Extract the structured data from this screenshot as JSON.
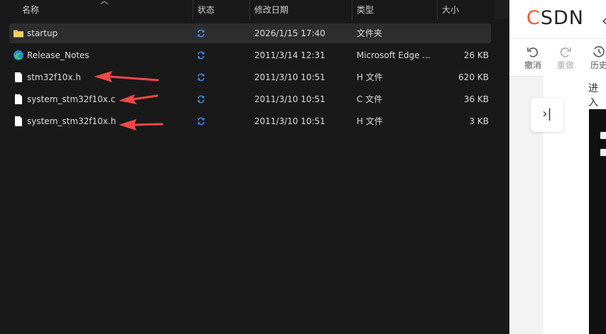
{
  "explorer": {
    "columns": {
      "name": "名称",
      "status": "状态",
      "date": "修改日期",
      "type": "类型",
      "size": "大小"
    },
    "files": [
      {
        "name": "startup",
        "date": "2026/1/15 17:40",
        "type": "文件夹",
        "size": "",
        "icon": "folder-icon"
      },
      {
        "name": "Release_Notes",
        "date": "2011/3/14 12:31",
        "type": "Microsoft Edge ...",
        "size": "26 KB",
        "icon": "edge-icon"
      },
      {
        "name": "stm32f10x.h",
        "date": "2011/3/10 10:51",
        "type": "H 文件",
        "size": "620 KB",
        "icon": "file-icon"
      },
      {
        "name": "system_stm32f10x.c",
        "date": "2011/3/10 10:51",
        "type": "C 文件",
        "size": "36 KB",
        "icon": "file-icon"
      },
      {
        "name": "system_stm32f10x.h",
        "date": "2011/3/10 10:51",
        "type": "H 文件",
        "size": "3 KB",
        "icon": "file-icon"
      }
    ],
    "annotation_color": "#f04848",
    "sync_color": "#3a8ee6"
  },
  "csdn": {
    "logo": "CSDN",
    "brand_color": "#fc5531",
    "toolbar": {
      "undo": "撤消",
      "redo": "重做",
      "history": "历史"
    },
    "body_text": "进入"
  }
}
